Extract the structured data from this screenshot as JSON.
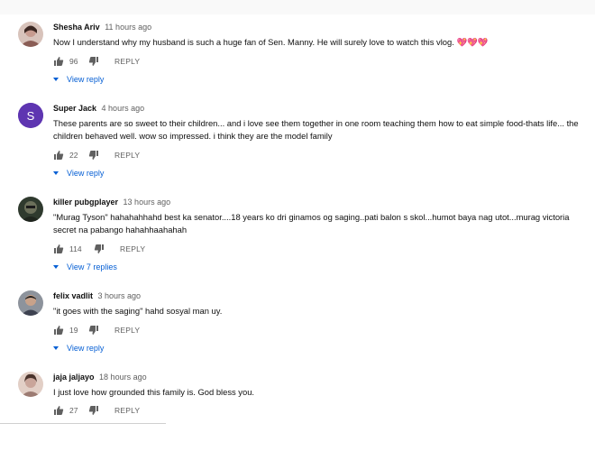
{
  "comments": [
    {
      "author": "Shesha Ariv",
      "time": "11 hours ago",
      "text": "Now I understand why my husband is such a huge fan of Sen. Manny. He will surely love to watch this vlog. 💖💖💖",
      "likes": "96",
      "reply_label": "REPLY",
      "view_replies": "View reply",
      "avatar_icon": "user-photo-avatar",
      "avatar_color": "#c79b8f"
    },
    {
      "author": "Super Jack",
      "time": "4 hours ago",
      "text": "These parents are so sweet to their children... and i love see them together in one room teaching them how to eat simple food-thats life... the children behaved well. wow so impressed. i think they are the model family",
      "likes": "22",
      "reply_label": "REPLY",
      "view_replies": "View reply",
      "avatar_icon": "letter-avatar",
      "avatar_letter": "S",
      "avatar_color": "#5e35b1"
    },
    {
      "author": "killer pubgplayer",
      "time": "13 hours ago",
      "text": "\"Murag Tyson\" hahahahhahd best ka senator....18 years ko dri ginamos og saging..pati balon s skol...humot baya nag utot...murag victoria secret na pabango hahahhaahahah",
      "likes": "114",
      "reply_label": "REPLY",
      "view_replies": "View 7 replies",
      "avatar_icon": "user-photo-avatar",
      "avatar_color": "#3d4a3a"
    },
    {
      "author": "felix vadlit",
      "time": "3 hours ago",
      "text": "\"it goes with the saging\" hahd sosyal man uy.",
      "likes": "19",
      "reply_label": "REPLY",
      "view_replies": "View reply",
      "avatar_icon": "user-photo-avatar",
      "avatar_color": "#6b6f78"
    },
    {
      "author": "jaja jaljayo",
      "time": "18 hours ago",
      "text": "I just love how grounded this family is. God bless you.",
      "likes": "27",
      "reply_label": "REPLY",
      "avatar_icon": "user-photo-avatar",
      "avatar_color": "#c9a59a"
    }
  ],
  "icons": {
    "like": "thumbs-up-icon",
    "dislike": "thumbs-down-icon",
    "expand": "triangle-down-icon"
  },
  "colors": {
    "link_blue": "#065fd4",
    "secondary_text": "#606060"
  }
}
